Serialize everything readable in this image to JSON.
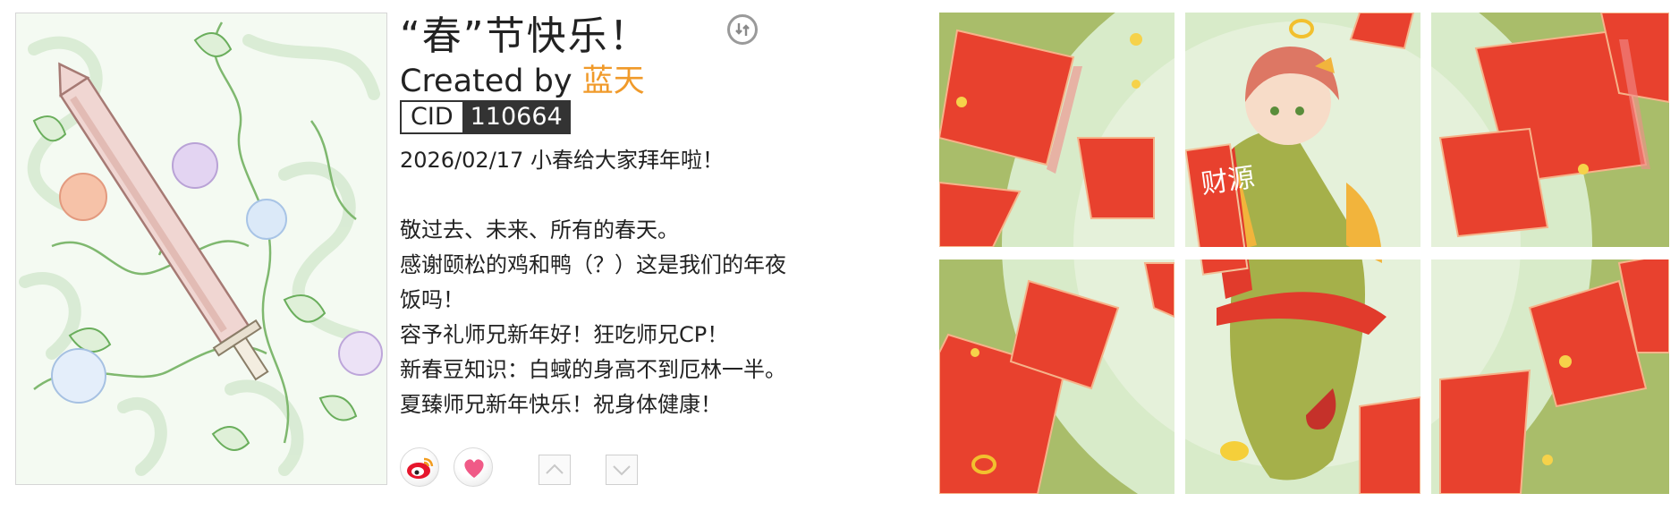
{
  "work": {
    "title": "“春”节快乐！",
    "created_by_label": "Created by",
    "author": "蓝天",
    "cid_label": "CID",
    "cid": "110664"
  },
  "description": {
    "line1": "2026/02/17 小春给大家拜年啦！",
    "line2": "敬过去、未来、所有的春天。",
    "line3": "感谢颐松的鸡和鸭（？）这是我们的年夜",
    "line4": "饭吗！",
    "line5": "容予礼师兄新年好！狂吃师兄CP！",
    "line6": "新春豆知识：白蜮的身高不到厄林一半。",
    "line7": "夏臻师兄新年快乐！祝身体健康！"
  },
  "gallery": {
    "banner_text": "财源"
  },
  "icons": {
    "switch": "switch-icon",
    "weibo": "weibo-share-icon",
    "like": "heart-icon",
    "up": "chevron-up-icon",
    "down": "chevron-down-icon"
  },
  "colors": {
    "author": "#f09a2a",
    "cid_bg": "#333333",
    "envelope_red": "#e8412e",
    "like_pink": "#f05a87",
    "weibo_red": "#e6162d"
  }
}
